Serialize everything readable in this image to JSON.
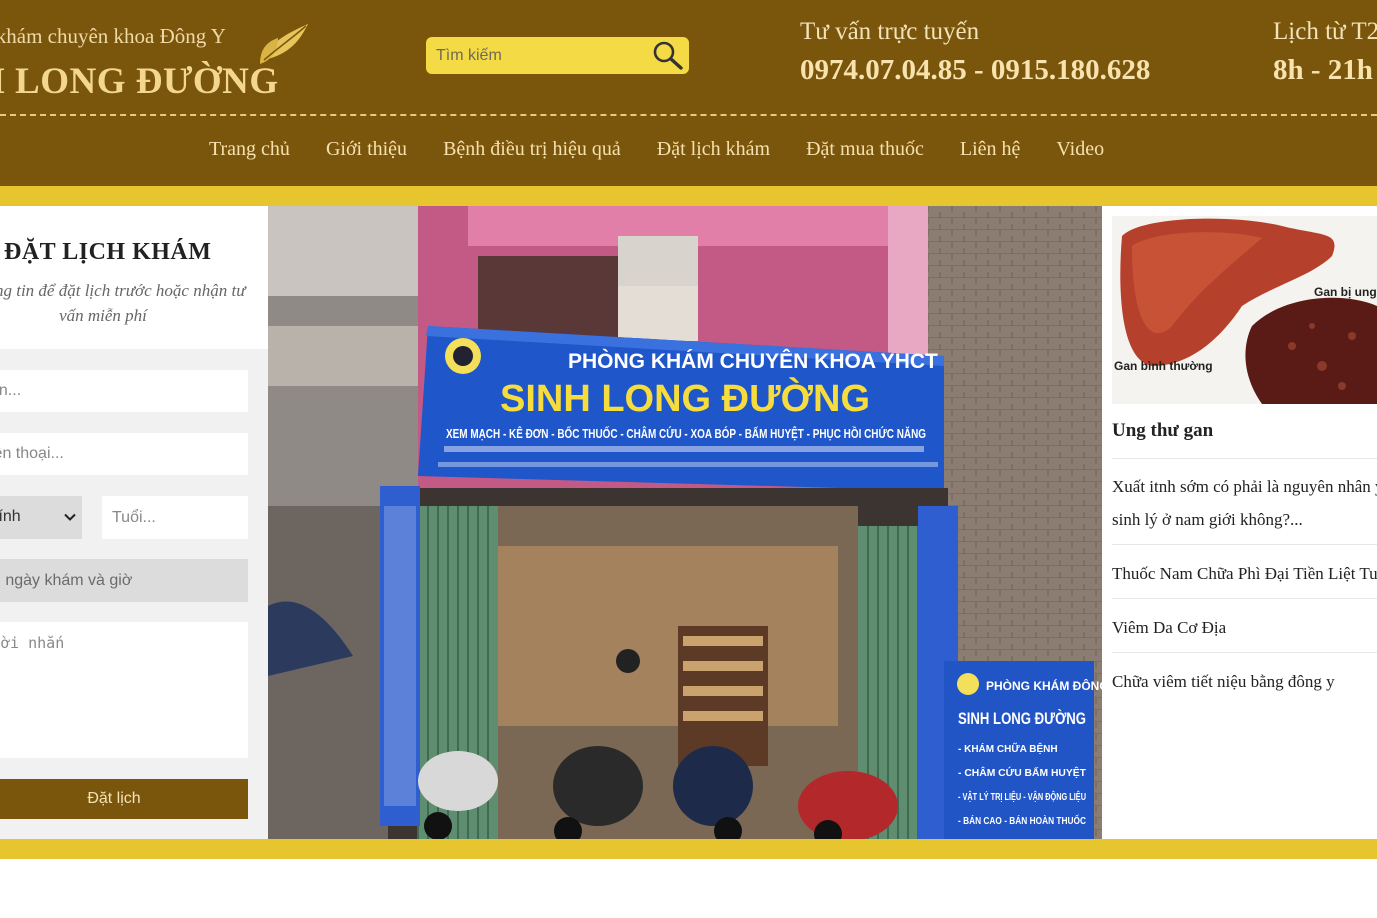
{
  "brand": {
    "tagline": "g khám chuyên khoa Đông Y",
    "name": "H LONG ĐƯỜNG"
  },
  "search": {
    "placeholder": "Tìm kiếm",
    "icon": "search-icon"
  },
  "hotline": {
    "title": "Tư vấn trực tuyến",
    "numbers": "0974.07.04.85 - 0915.180.628"
  },
  "hours": {
    "title": "Lịch từ T2",
    "time": "8h - 21h"
  },
  "nav": {
    "items": [
      {
        "label": "Trang chủ"
      },
      {
        "label": "Giới thiệu"
      },
      {
        "label": "Bệnh điều trị hiệu quả"
      },
      {
        "label": "Đặt lịch khám"
      },
      {
        "label": "Đặt mua thuốc"
      },
      {
        "label": "Liên hệ"
      },
      {
        "label": "Video"
      }
    ]
  },
  "booking": {
    "title": "ĐẶT LỊCH KHÁM",
    "desc": "n thông tin để đặt lịch trước hoặc nhận tư vấn miễn phí",
    "name_placeholder": "ên...",
    "phone_placeholder": "iện thoại...",
    "gender_value": "i tính",
    "age_placeholder": "Tuổi...",
    "date_label": "n ngày khám và giờ",
    "message_placeholder": "lời nhắn",
    "submit": "Đặt lịch"
  },
  "photo": {
    "sign_line1": "PHÒNG KHÁM CHUYÊN KHOA YHCT",
    "sign_line2": "SINH LONG ĐƯỜNG",
    "sign_line3": "XEM MẠCH - KÊ ĐƠN - BỐC THUỐC - CHÂM CỨU - XOA BÓP - BẤM HUYỆT - PHỤC HỒI CHỨC NĂNG",
    "side_sign_line1": "PHÒNG KHÁM ĐÔNG Y",
    "side_sign_line2": "SINH LONG ĐƯỜNG",
    "side_sign_items": [
      "- KHÁM CHỮA BỆNH",
      "- CHÂM CỨU BẤM HUYỆT",
      "- VẬT LÝ TRỊ LIỆU - VẬN ĐỘNG LIỆU",
      "- BÁN CAO - BÁN HOÀN THUỐC"
    ]
  },
  "sidebar": {
    "image": {
      "label_normal": "Gan bình thường",
      "label_sick": "Gan bị ung"
    },
    "featured": "Ung thư gan",
    "links": [
      {
        "text": "Xuất itnh sớm có phải là nguyên nhân y"
      },
      {
        "text": "sinh lý ở nam giới không?..."
      },
      {
        "text": "Thuốc Nam Chữa Phì Đại Tiền Liệt Tu"
      },
      {
        "text": "Viêm Da Cơ Địa"
      },
      {
        "text": "Chữa viêm tiết niệu bằng đông y"
      }
    ]
  },
  "colors": {
    "header_bg": "#7a560c",
    "gold_band": "#e6c52e",
    "search_bg": "#f4da45",
    "header_text": "#f6e0ae"
  }
}
